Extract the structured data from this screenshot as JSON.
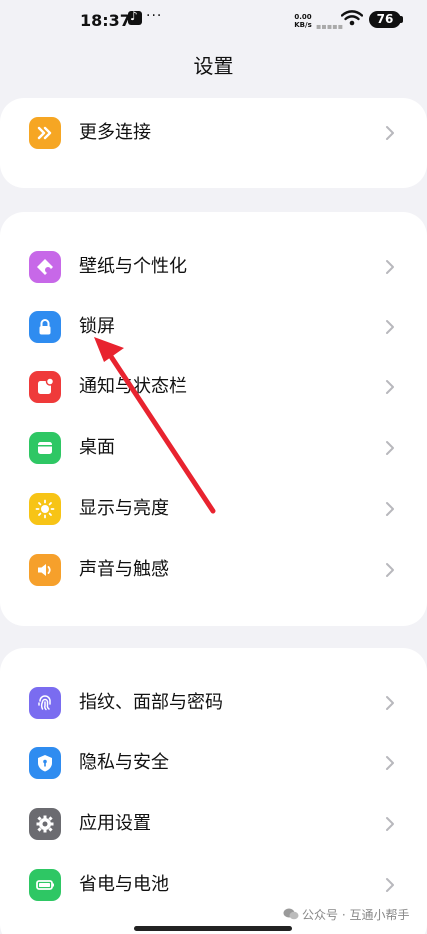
{
  "status_bar": {
    "time": "18:37",
    "app_icon": "tiktok-icon",
    "more": "···",
    "net_speed_value": "0.00",
    "net_speed_unit": "KB/s",
    "wifi_icon": "wifi-icon",
    "battery": "76"
  },
  "page": {
    "title": "设置"
  },
  "groups": [
    {
      "items": [
        {
          "label": "更多连接",
          "icon": "connection-icon",
          "color": "#f6a623"
        }
      ]
    },
    {
      "items": [
        {
          "label": "壁纸与个性化",
          "icon": "wallpaper-icon",
          "color": "#c768e8"
        },
        {
          "label": "锁屏",
          "icon": "lock-icon",
          "color": "#2f8cf0"
        },
        {
          "label": "通知与状态栏",
          "icon": "notification-icon",
          "color": "#ef3a3a"
        },
        {
          "label": "桌面",
          "icon": "desktop-icon",
          "color": "#2ec764"
        },
        {
          "label": "显示与亮度",
          "icon": "brightness-icon",
          "color": "#f7c416"
        },
        {
          "label": "声音与触感",
          "icon": "sound-icon",
          "color": "#f6a02b"
        }
      ]
    },
    {
      "items": [
        {
          "label": "指纹、面部与密码",
          "icon": "fingerprint-icon",
          "color": "#7a6cf0"
        },
        {
          "label": "隐私与安全",
          "icon": "privacy-shield-icon",
          "color": "#2f8cf0"
        },
        {
          "label": "应用设置",
          "icon": "gear-icon",
          "color": "#6b6b70"
        },
        {
          "label": "省电与电池",
          "icon": "battery-icon",
          "color": "#2ec764"
        }
      ]
    }
  ],
  "annotation": {
    "arrow_color": "#e8232f"
  },
  "watermark": {
    "text": "公众号 · 互通小帮手"
  }
}
